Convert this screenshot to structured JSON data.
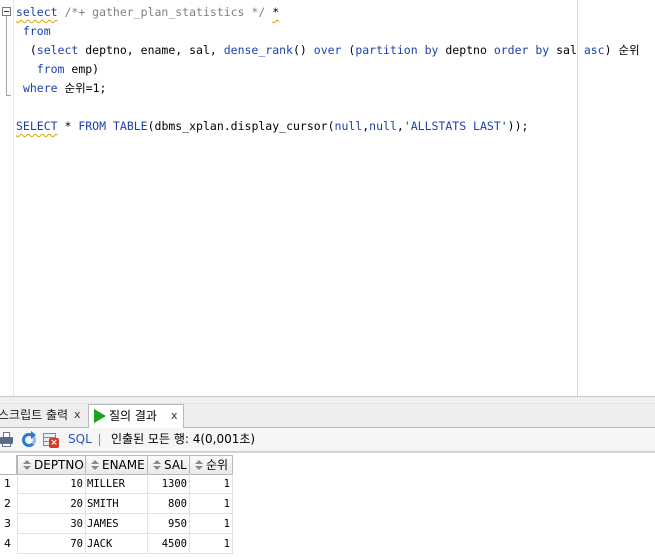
{
  "editor": {
    "lines": [
      {
        "parts": [
          {
            "t": "select",
            "c": "kw sq"
          },
          {
            "t": " /*+ gather_plan_statistics */ ",
            "c": "cm"
          },
          {
            "t": "*",
            "c": "sq"
          }
        ]
      },
      {
        "parts": [
          {
            "t": " from",
            "c": "kw"
          }
        ]
      },
      {
        "parts": [
          {
            "t": "  (",
            "c": ""
          },
          {
            "t": "select",
            "c": "kw"
          },
          {
            "t": " deptno, ename, sal, ",
            "c": ""
          },
          {
            "t": "dense_rank",
            "c": "kw"
          },
          {
            "t": "() ",
            "c": ""
          },
          {
            "t": "over",
            "c": "kw"
          },
          {
            "t": " (",
            "c": ""
          },
          {
            "t": "partition by",
            "c": "kw"
          },
          {
            "t": " deptno ",
            "c": ""
          },
          {
            "t": "order by",
            "c": "kw"
          },
          {
            "t": " sal ",
            "c": ""
          },
          {
            "t": "asc",
            "c": "kw"
          },
          {
            "t": ") 순위",
            "c": ""
          }
        ]
      },
      {
        "parts": [
          {
            "t": "   ",
            "c": ""
          },
          {
            "t": "from",
            "c": "kw"
          },
          {
            "t": " emp)",
            "c": ""
          }
        ]
      },
      {
        "parts": [
          {
            "t": " ",
            "c": ""
          },
          {
            "t": "where",
            "c": "kw"
          },
          {
            "t": " 순위=1;",
            "c": ""
          }
        ]
      },
      {
        "parts": [
          {
            "t": "",
            "c": ""
          }
        ]
      },
      {
        "parts": [
          {
            "t": "SELECT",
            "c": "kw sq"
          },
          {
            "t": " * ",
            "c": ""
          },
          {
            "t": "FROM",
            "c": "kw"
          },
          {
            "t": " ",
            "c": ""
          },
          {
            "t": "TABLE",
            "c": "kw"
          },
          {
            "t": "(dbms_xplan.display_cursor(",
            "c": ""
          },
          {
            "t": "null",
            "c": "kw"
          },
          {
            "t": ",",
            "c": ""
          },
          {
            "t": "null",
            "c": "kw"
          },
          {
            "t": ",",
            "c": ""
          },
          {
            "t": "'ALLSTATS LAST'",
            "c": "st"
          },
          {
            "t": "));",
            "c": ""
          }
        ]
      }
    ]
  },
  "tabs": {
    "script_output": {
      "label": "스크립트 출력",
      "close": "x"
    },
    "query_result": {
      "label": "질의 결과",
      "close": "x"
    }
  },
  "toolbar": {
    "sql_label": "SQL",
    "status": "인출된 모든 행: 4(0,001초)"
  },
  "grid": {
    "columns": [
      "DEPTNO",
      "ENAME",
      "SAL",
      "순위"
    ],
    "rows": [
      {
        "num": "1",
        "deptno": "10",
        "ename": "MILLER",
        "sal": "1300",
        "rank": "1"
      },
      {
        "num": "2",
        "deptno": "20",
        "ename": "SMITH",
        "sal": "800",
        "rank": "1"
      },
      {
        "num": "3",
        "deptno": "30",
        "ename": "JAMES",
        "sal": "950",
        "rank": "1"
      },
      {
        "num": "4",
        "deptno": "70",
        "ename": "JACK",
        "sal": "4500",
        "rank": "1"
      }
    ]
  }
}
